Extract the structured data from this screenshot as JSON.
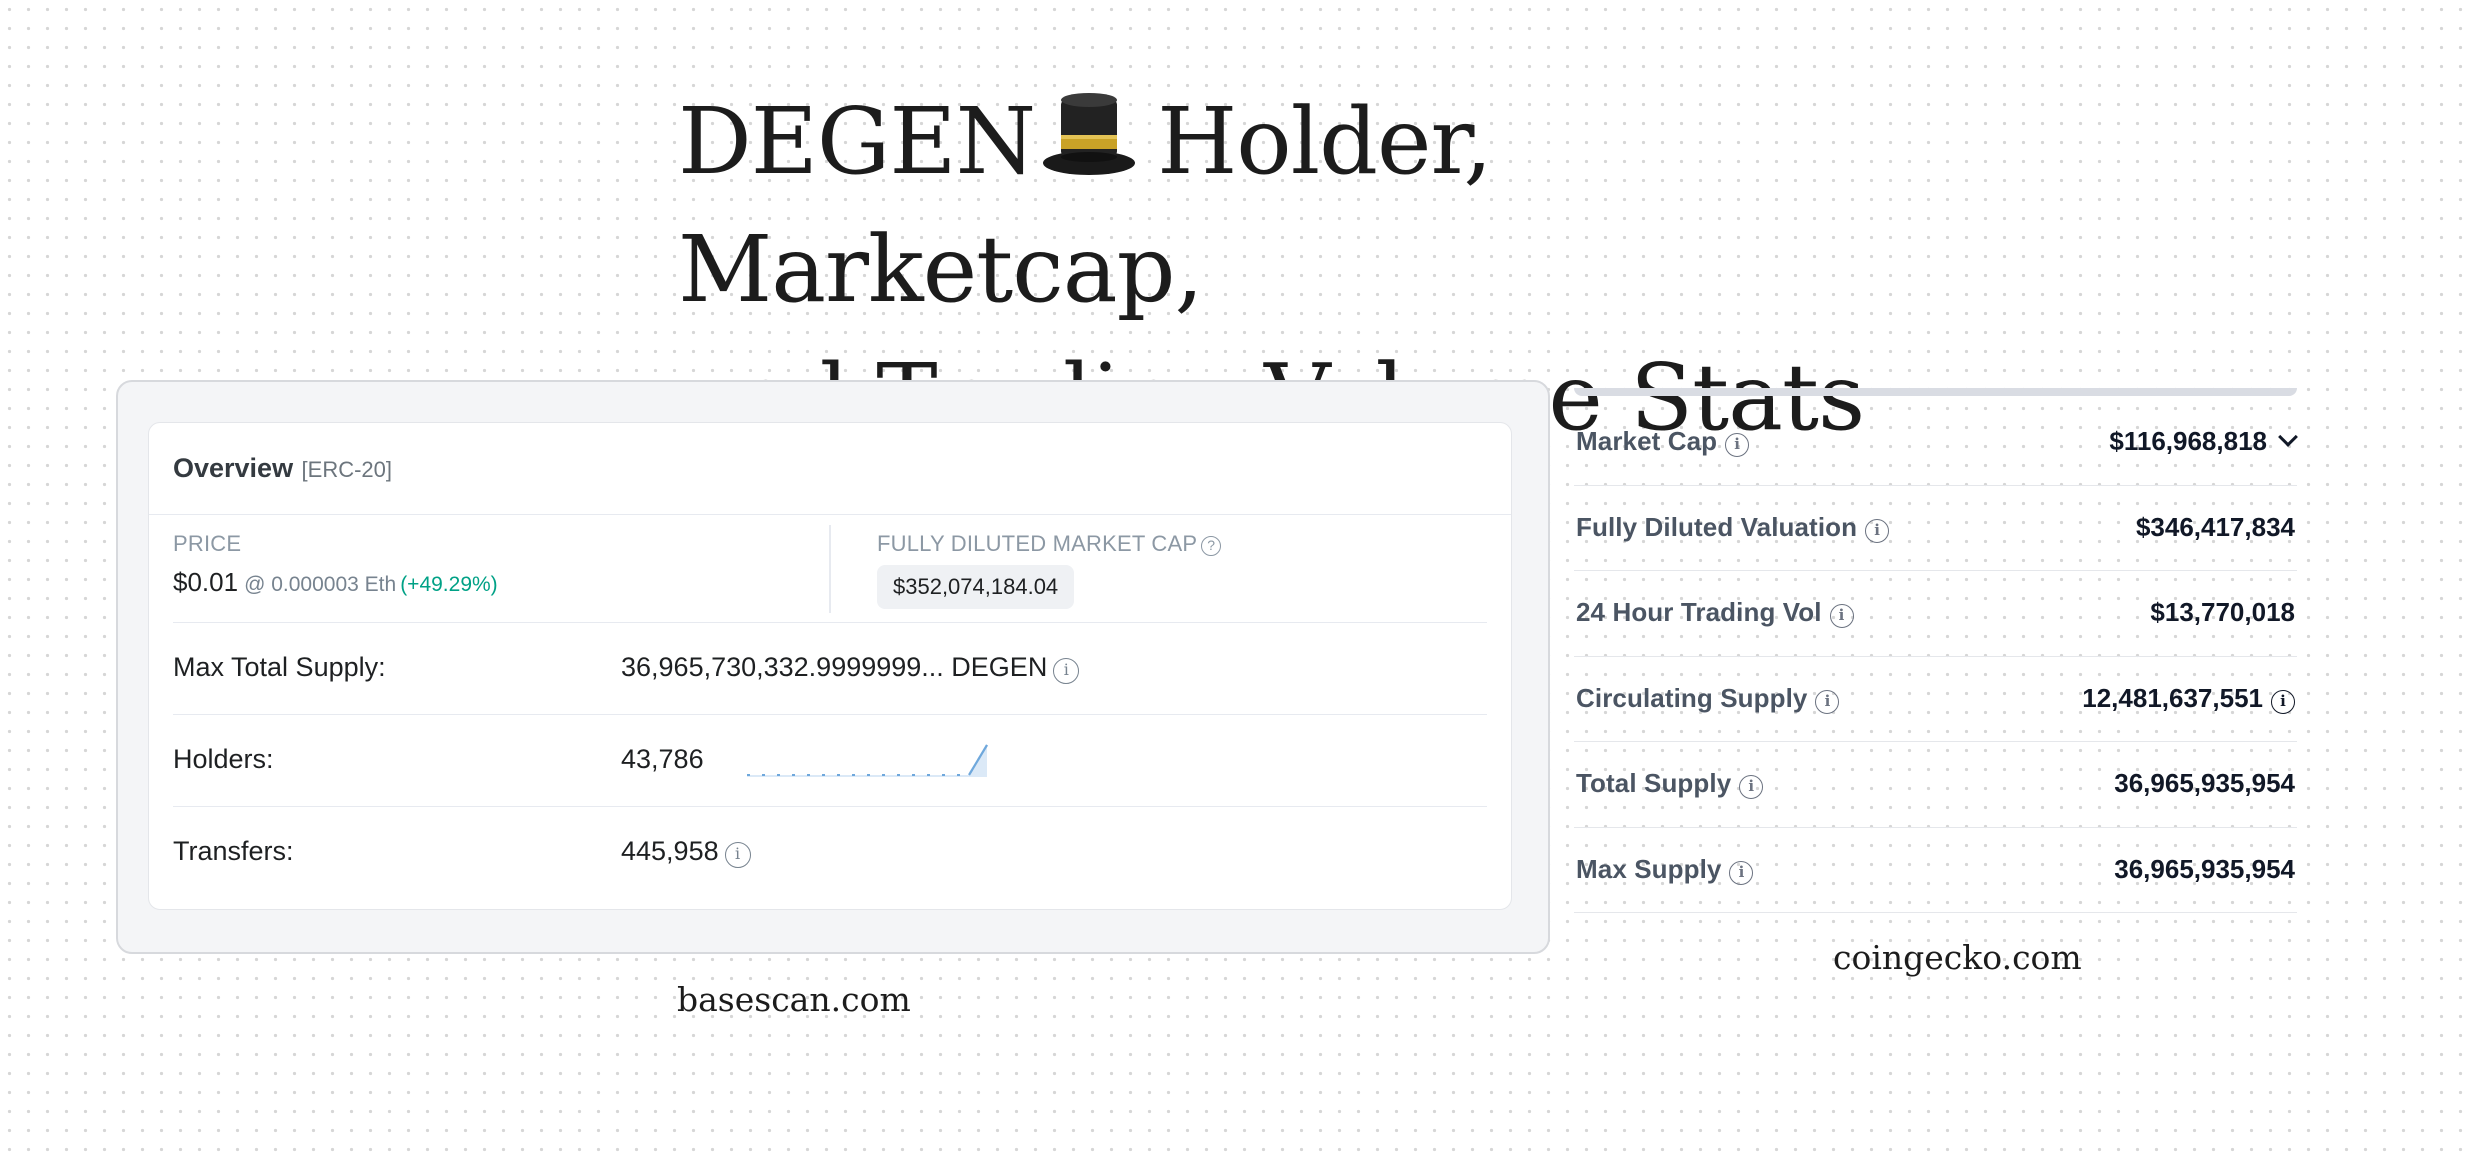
{
  "title": {
    "line1_pre": "DEGEN",
    "hat_icon": "top-hat-icon",
    "line1_post": "Holder, Marketcap,",
    "line2": "and Trading Volume Stats"
  },
  "basescan": {
    "overview_title": "Overview",
    "overview_tag": "[ERC-20]",
    "price_label": "PRICE",
    "price_value": "$0.01",
    "price_eth": "@ 0.000003 Eth",
    "price_change": "(+49.29%)",
    "fdmc_label": "FULLY DILUTED MARKET CAP",
    "fdmc_value": "$352,074,184.04",
    "rows": [
      {
        "label": "Max Total Supply:",
        "value": "36,965,730,332.9999999... DEGEN"
      },
      {
        "label": "Holders:",
        "value": "43,786"
      },
      {
        "label": "Transfers:",
        "value": "445,958"
      }
    ],
    "caption": "basescan.com"
  },
  "coingecko": {
    "rows": [
      {
        "label": "Market Cap",
        "value": "$116,968,818"
      },
      {
        "label": "Fully Diluted Valuation",
        "value": "$346,417,834"
      },
      {
        "label": "24 Hour Trading Vol",
        "value": "$13,770,018"
      },
      {
        "label": "Circulating Supply",
        "value": "12,481,637,551"
      },
      {
        "label": "Total Supply",
        "value": "36,965,935,954"
      },
      {
        "label": "Max Supply",
        "value": "36,965,935,954"
      }
    ],
    "caption": "coingecko.com"
  },
  "colors": {
    "positive": "#00a186",
    "sparkline": "#6fa8dc"
  }
}
